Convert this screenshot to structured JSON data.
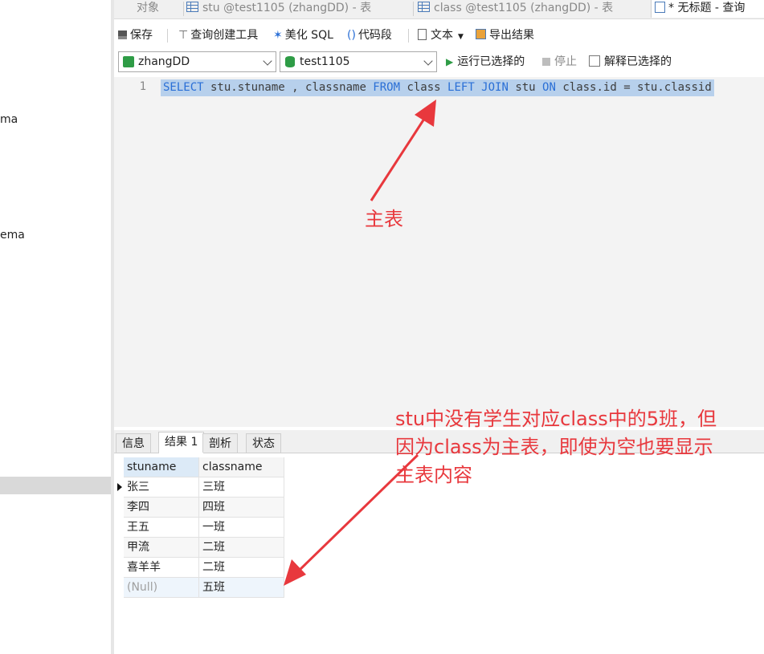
{
  "left_panel": {
    "items": [
      {
        "text": "ma"
      },
      {
        "text": "ema"
      }
    ]
  },
  "tabs": [
    {
      "label": "对象"
    },
    {
      "label": "stu @test1105 (zhangDD) - 表"
    },
    {
      "label": "class @test1105 (zhangDD) - 表"
    },
    {
      "label": "* 无标题 - 查询"
    }
  ],
  "toolbar": {
    "save": "保存",
    "query_builder": "查询创建工具",
    "beautify": "美化 SQL",
    "snippet": "代码段",
    "text": "文本",
    "export": "导出结果"
  },
  "selectors": {
    "connection": "zhangDD",
    "database": "test1105",
    "run_selected": "运行已选择的",
    "stop": "停止",
    "explain_selected": "解释已选择的"
  },
  "editor": {
    "line_number": "1",
    "sql": [
      {
        "t": "SELECT",
        "k": true
      },
      {
        "t": " stu.stuname , classname ",
        "k": false
      },
      {
        "t": "FROM",
        "k": true
      },
      {
        "t": " class ",
        "k": false
      },
      {
        "t": "LEFT JOIN",
        "k": true
      },
      {
        "t": " stu ",
        "k": false
      },
      {
        "t": "ON",
        "k": true
      },
      {
        "t": " class.id = stu.classid",
        "k": false
      }
    ]
  },
  "result_tabs": [
    {
      "label": "信息"
    },
    {
      "label": "结果 1",
      "active": true
    },
    {
      "label": "剖析"
    },
    {
      "label": "状态"
    }
  ],
  "grid": {
    "columns": [
      "stuname",
      "classname"
    ],
    "rows": [
      [
        "张三",
        "三班"
      ],
      [
        "李四",
        "四班"
      ],
      [
        "王五",
        "一班"
      ],
      [
        "甲流",
        "二班"
      ],
      [
        "喜羊羊",
        "二班"
      ],
      [
        "(Null)",
        "五班"
      ]
    ]
  },
  "annotations": {
    "main_table": "主表",
    "note_lines": [
      "stu中没有学生对应class中的5班，但",
      "因为class为主表，即使为空也要显示",
      "主表内容"
    ]
  },
  "colors": {
    "annotation": "#e8383d",
    "keyword": "#2a6fd6",
    "selection": "#b7d0ec"
  }
}
